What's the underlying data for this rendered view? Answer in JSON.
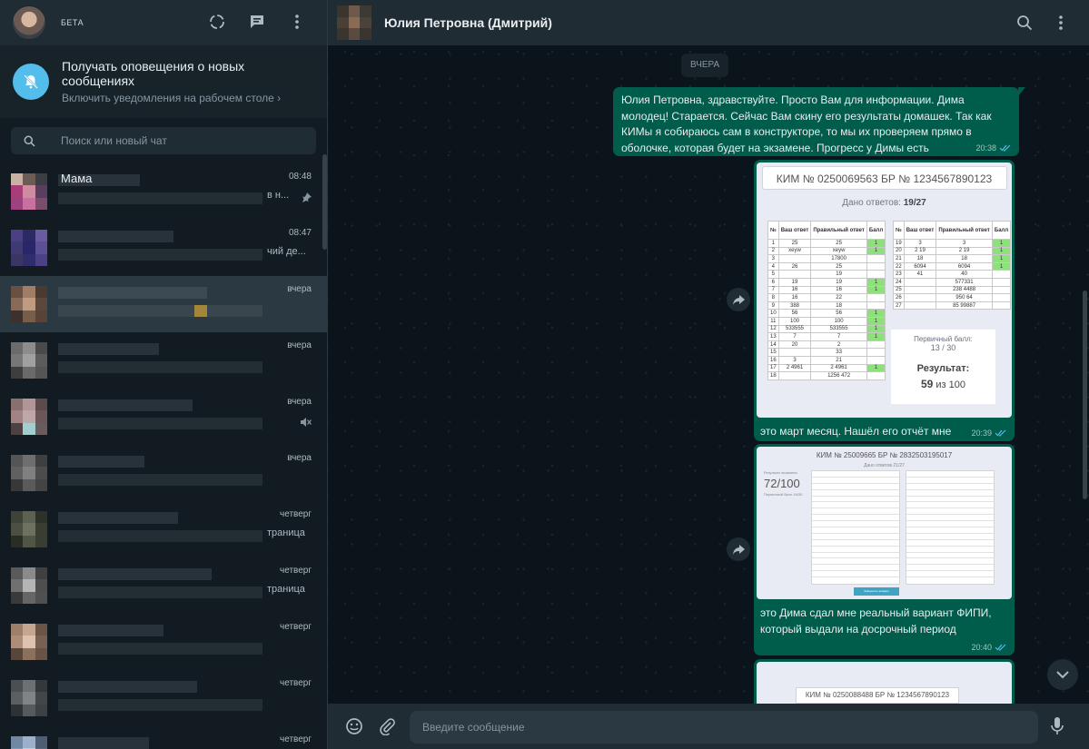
{
  "sidebar": {
    "header": {
      "beta_label": "БЕТА",
      "icons": [
        "status-icon",
        "new-chat-icon",
        "menu-icon"
      ]
    },
    "notification": {
      "title": "Получать оповещения о новых сообщениях",
      "subtitle": "Включить уведомления на рабочем столе ›"
    },
    "search": {
      "placeholder": "Поиск или новый чат"
    },
    "chats": [
      {
        "name": "Мама",
        "time": "08:48",
        "snippet": "в н...",
        "pinned": true
      },
      {
        "name": "",
        "time": "08:47",
        "snippet": "чий де..."
      },
      {
        "name": "",
        "time": "вчера",
        "snippet": "",
        "active": true
      },
      {
        "name": "",
        "time": "вчера",
        "snippet": ""
      },
      {
        "name": "",
        "time": "вчера",
        "snippet": "",
        "muted": true
      },
      {
        "name": "",
        "time": "вчера",
        "snippet": ""
      },
      {
        "name": "",
        "time": "четверг",
        "snippet": "траница"
      },
      {
        "name": "",
        "time": "четверг",
        "snippet": "траница"
      },
      {
        "name": "",
        "time": "четверг",
        "snippet": ""
      },
      {
        "name": "",
        "time": "четверг",
        "snippet": ""
      },
      {
        "name": "",
        "time": "четверг",
        "snippet": ""
      }
    ]
  },
  "conversation": {
    "title": "Юлия Петровна (Дмитрий)",
    "day_label": "ВЧЕРА",
    "messages": [
      {
        "text": "Юлия Петровна, здравствуйте. Просто Вам для информации. Дима молодец! Старается. Сейчас Вам скину его результаты домашек. Так как КИМы я собираюсь сам в конструкторе, то мы их проверяем прямо в оболочке, которая будет на экзамене.  Прогресс у Димы есть",
        "time": "20:38"
      },
      {
        "caption": "это март месяц. Нашёл его отчёт мне",
        "time": "20:39"
      },
      {
        "caption": "это Дима сдал мне реальный вариант ФИПИ, который выдали на досрочный период",
        "time": "20:40"
      }
    ],
    "report1": {
      "title": "КИМ № 0250069563 БР № 1234567890123",
      "answers_label": "Дано ответов:",
      "answers_value": "19/27",
      "headers": [
        "№",
        "Ваш ответ",
        "Правильный ответ",
        "Балл"
      ],
      "left_rows": [
        [
          "1",
          "25",
          "25",
          "1"
        ],
        [
          "2",
          "xeyw",
          "xeyw",
          "1"
        ],
        [
          "3",
          "",
          "17800",
          ""
        ],
        [
          "4",
          "26",
          "25",
          ""
        ],
        [
          "5",
          "",
          "19",
          ""
        ],
        [
          "6",
          "19",
          "19",
          "1"
        ],
        [
          "7",
          "16",
          "16",
          "1"
        ],
        [
          "8",
          "16",
          "22",
          ""
        ],
        [
          "9",
          "388",
          "18",
          ""
        ],
        [
          "10",
          "56",
          "56",
          "1"
        ],
        [
          "11",
          "100",
          "100",
          "1"
        ],
        [
          "12",
          "533555",
          "533555",
          "1"
        ],
        [
          "13",
          "7",
          "7",
          "1"
        ],
        [
          "14",
          "20",
          "2",
          ""
        ],
        [
          "15",
          "",
          "33",
          ""
        ],
        [
          "16",
          "3",
          "21",
          ""
        ],
        [
          "17",
          "2 4961",
          "2 4961",
          "1"
        ],
        [
          "18",
          "",
          "1256 472",
          ""
        ]
      ],
      "right_rows": [
        [
          "19",
          "3",
          "3",
          "1"
        ],
        [
          "20",
          "2 19",
          "2 19",
          "1"
        ],
        [
          "21",
          "18",
          "18",
          "1"
        ],
        [
          "22",
          "6094",
          "6094",
          "1"
        ],
        [
          "23",
          "41",
          "40",
          ""
        ],
        [
          "24",
          "",
          "577331",
          ""
        ],
        [
          "25",
          "",
          "238 4488",
          ""
        ],
        [
          "26",
          "",
          "950 64",
          ""
        ],
        [
          "27",
          "",
          "85 99887",
          ""
        ]
      ],
      "primary_label": "Первичный балл:",
      "primary_value": "13 / 30",
      "result_label": "Результат:",
      "result_value": "59",
      "result_suffix": "из 100"
    },
    "report2": {
      "title": "КИМ № 25009665 БР № 2832503195017",
      "answers": "Дано ответов 21/27",
      "score_label": "Результат экзамена",
      "score": "72/100",
      "primary": "Первичный балл 16/30",
      "button": "Завершить экзамен"
    },
    "report3": {
      "title": "КИМ № 0250088488 БР № 1234567890123"
    },
    "composer": {
      "placeholder": "Введите сообщение"
    }
  },
  "colors": {
    "bubble_out": "#005c4b",
    "panel": "#202c33",
    "background": "#0b141a",
    "accent": "#53bdeb"
  }
}
